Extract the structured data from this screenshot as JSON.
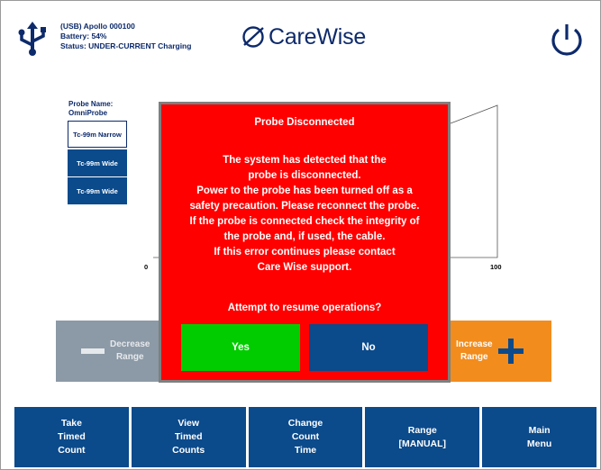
{
  "header": {
    "device_line": "(USB) Apollo 000100",
    "battery_line": "Battery: 54%",
    "status_line": "Status: UNDER-CURRENT Charging",
    "logo_text": "CareWise",
    "brand_color": "#0d2a6b"
  },
  "probe": {
    "name_label": "Probe Name:",
    "name_value": "OmniProbe",
    "items": [
      {
        "label": "Tc-99m Narrow",
        "selected": true
      },
      {
        "label": "Tc-99m Wide",
        "selected": false
      },
      {
        "label": "Tc-99m Wide",
        "selected": false
      }
    ]
  },
  "chart": {
    "tick_min": "0",
    "tick_max": "100"
  },
  "range_controls": {
    "decrease_label_1": "Decrease",
    "decrease_label_2": "Range",
    "increase_label_1": "Increase",
    "increase_label_2": "Range"
  },
  "bottom_nav": [
    {
      "label": "Take\nTimed\nCount"
    },
    {
      "label": "View\nTimed\nCounts"
    },
    {
      "label": "Change\nCount\nTime"
    },
    {
      "label": "Range\n[MANUAL]"
    },
    {
      "label": "Main\nMenu"
    }
  ],
  "dialog": {
    "title": "Probe Disconnected",
    "body_lines": [
      "The system has detected that the",
      "probe is disconnected.",
      "Power to the probe has been turned off as a",
      "safety precaution. Please reconnect the probe.",
      "If the probe is connected check the integrity of",
      "the probe and, if used, the cable.",
      "If this error continues please contact",
      "Care Wise support."
    ],
    "question": "Attempt to resume operations?",
    "yes_label": "Yes",
    "no_label": "No"
  },
  "colors": {
    "nav_blue": "#0b4a8b",
    "dialog_red": "#ff0000",
    "yes_green": "#00cc00",
    "increase_orange": "#f28c1d",
    "decrease_gray": "#8c99a6"
  }
}
